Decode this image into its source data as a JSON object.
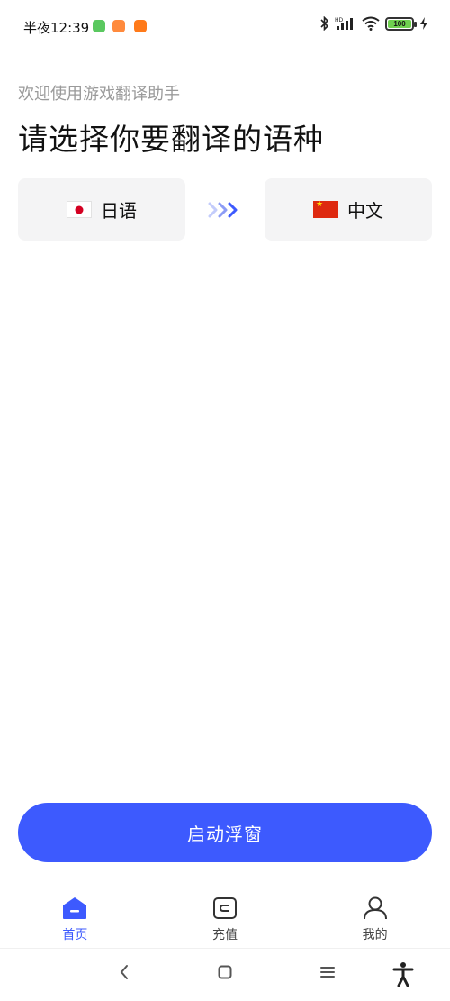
{
  "status_bar": {
    "time": "半夜12:39",
    "battery_level": "100",
    "icons": [
      "bluetooth-icon",
      "hd-signal-icon",
      "wifi-icon",
      "battery-icon",
      "charging-icon"
    ]
  },
  "header": {
    "welcome": "欢迎使用游戏翻译助手",
    "title": "请选择你要翻译的语种"
  },
  "language": {
    "source": {
      "name": "日语",
      "flag": "japan-flag-icon"
    },
    "target": {
      "name": "中文",
      "flag": "china-flag-icon"
    }
  },
  "start_button": {
    "label": "启动浮窗"
  },
  "tabs": [
    {
      "label": "首页",
      "icon": "home-icon",
      "active": true
    },
    {
      "label": "充值",
      "icon": "wallet-icon",
      "active": false
    },
    {
      "label": "我的",
      "icon": "user-icon",
      "active": false
    }
  ],
  "colors": {
    "accent": "#3d5afe",
    "card_bg": "#f4f4f5",
    "muted_text": "#9a9a9a"
  }
}
